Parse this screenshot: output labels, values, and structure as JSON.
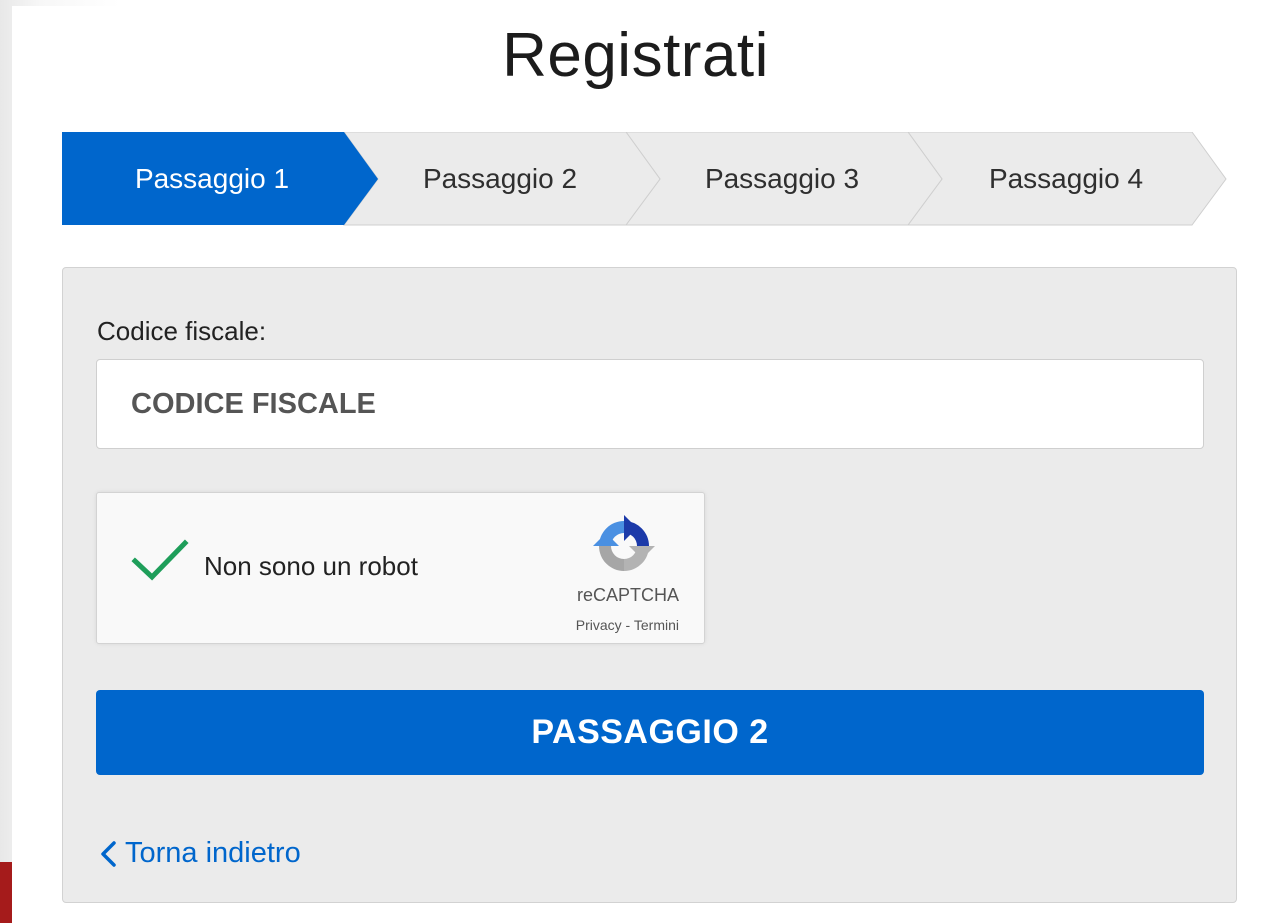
{
  "page": {
    "title": "Registrati"
  },
  "stepper": {
    "steps": [
      {
        "label": "Passaggio 1",
        "active": true
      },
      {
        "label": "Passaggio 2",
        "active": false
      },
      {
        "label": "Passaggio 3",
        "active": false
      },
      {
        "label": "Passaggio 4",
        "active": false
      }
    ],
    "active_color": "#0066cc",
    "inactive_color": "#ebebeb"
  },
  "form": {
    "codice_fiscale_label": "Codice fiscale:",
    "codice_fiscale_value": "",
    "codice_fiscale_placeholder": "CODICE FISCALE",
    "captcha": {
      "label": "Non sono un robot",
      "checked": true,
      "brand": "reCAPTCHA",
      "privacy_link": "Privacy",
      "separator": " - ",
      "terms_link": "Termini",
      "check_icon": "check-icon",
      "check_color": "#1e9e5a"
    },
    "submit_label": "PASSAGGIO 2",
    "back_link": "Torna indietro",
    "back_icon": "chevron-left-icon",
    "accent_color": "#0066cc"
  }
}
